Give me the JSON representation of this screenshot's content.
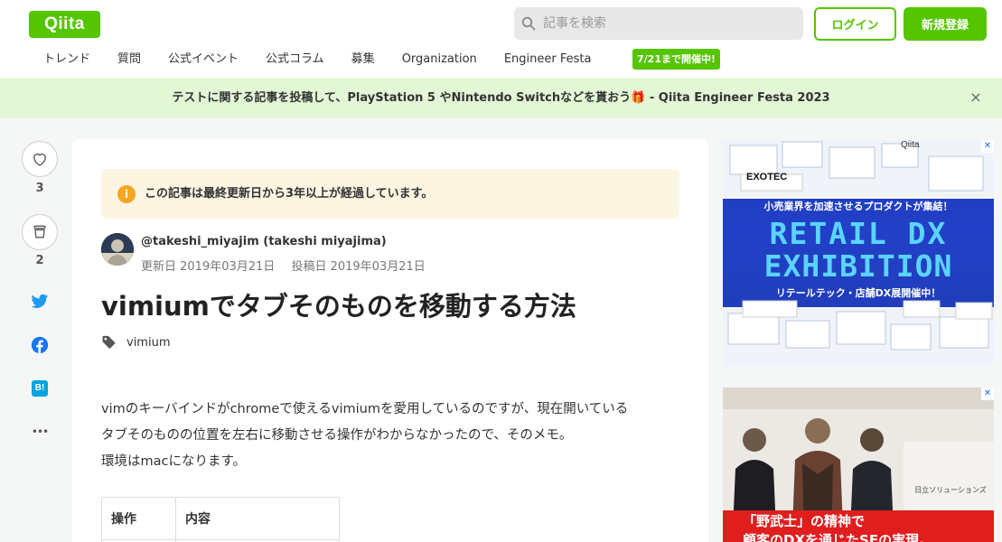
{
  "header": {
    "logo": "Qiita",
    "search_placeholder": "記事を検索",
    "login": "ログイン",
    "signup": "新規登録",
    "nav": [
      "トレンド",
      "質問",
      "公式イベント",
      "公式コラム",
      "募集",
      "Organization",
      "Engineer Festa"
    ],
    "festa_badge": "7/21まで開催中!"
  },
  "banner": {
    "text": "テストに関する記事を投稿して、PlayStation 5 やNintendo Switchなどを貰おう🎁 - Qiita Engineer Festa 2023",
    "close": "×"
  },
  "side": {
    "like_count": "3",
    "stock_count": "2",
    "hatena_label": "B!",
    "more": "•••"
  },
  "article": {
    "notice": "この記事は最終更新日から3年以上が経過しています。",
    "author": "@takeshi_miyajim (takeshi miyajima)",
    "updated": "更新日 2019年03月21日",
    "posted": "投稿日 2019年03月21日",
    "title": "vimiumでタブそのものを移動する方法",
    "tag": "vimium",
    "body": [
      "vimのキーバインドがchromeで使えるvimiumを愛用しているのですが、現在開いている",
      "タブそのものの位置を左右に移動させる操作がわからなかったので、そのメモ。",
      "環境はmacになります。"
    ],
    "table_headers": [
      "操作",
      "内容"
    ]
  },
  "ads": {
    "ad1_headline": "小売業界を加速させるプロダクトが集結！",
    "ad1_title_1": "RETAIL DX",
    "ad1_title_2": "EXHIBITION",
    "ad1_sub": "リテールテック・店舗DX展開催中！",
    "ad1_brand": "Qiita",
    "ad1_exotec": "EXOTEC",
    "ad2_sign": "日立ソリューションズ",
    "ad2_line1": "「野武士」の精神で",
    "ad2_line2": "顧客のDXを通じたSFの実現。"
  },
  "colors": {
    "brand": "#55c500",
    "banner_bg": "#e3f7d6",
    "notice_bg": "#fcf5e2",
    "twitter": "#1d9bf0",
    "facebook": "#1877f2",
    "hatena": "#00a4de"
  }
}
